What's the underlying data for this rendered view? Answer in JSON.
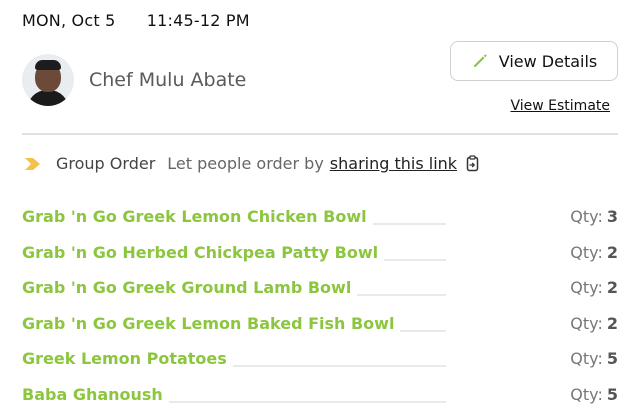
{
  "header": {
    "date": "MON, Oct 5",
    "time": "11:45-12 PM"
  },
  "chef": {
    "name": "Chef Mulu Abate",
    "avatar_icon": "chef-avatar"
  },
  "actions": {
    "view_details_label": "View Details",
    "view_details_icon": "pencil-icon",
    "view_estimate_label": "View Estimate"
  },
  "group_order": {
    "label": "Group Order",
    "hint": "Let people order by",
    "link_label": "sharing this link",
    "arrow_icon": "chevron-arrow-icon",
    "copy_icon": "copy-icon"
  },
  "items": [
    {
      "name": "Grab 'n Go Greek Lemon Chicken Bowl",
      "qty_label": "Qty:",
      "qty": "3"
    },
    {
      "name": "Grab 'n Go Herbed Chickpea Patty Bowl",
      "qty_label": "Qty:",
      "qty": "2"
    },
    {
      "name": "Grab 'n Go Greek Ground Lamb Bowl",
      "qty_label": "Qty:",
      "qty": "2"
    },
    {
      "name": "Grab 'n Go Greek Lemon Baked Fish Bowl",
      "qty_label": "Qty:",
      "qty": "2"
    },
    {
      "name": "Greek Lemon Potatoes",
      "qty_label": "Qty:",
      "qty": "5"
    },
    {
      "name": "Baba Ghanoush",
      "qty_label": "Qty:",
      "qty": "5"
    }
  ],
  "colors": {
    "item_accent": "#8cc63f",
    "arrow_accent": "#f4c24a",
    "pencil_accent": "#8cc63f"
  }
}
